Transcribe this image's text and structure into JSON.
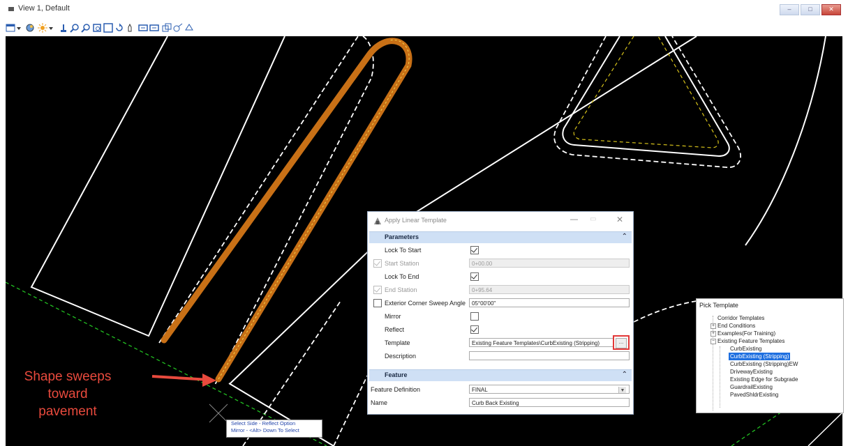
{
  "window": {
    "title": "View 1, Default",
    "controls": [
      "–",
      "□",
      "✕"
    ]
  },
  "dialog": {
    "title": "Apply Linear Template",
    "sections": {
      "parameters": "Parameters",
      "feature": "Feature"
    },
    "fields": {
      "lock_to_start": {
        "label": "Lock To Start",
        "checked": true
      },
      "start_station": {
        "label": "Start Station",
        "value": "0+00.00",
        "disabled": true
      },
      "lock_to_end": {
        "label": "Lock To End",
        "checked": true
      },
      "end_station": {
        "label": "End Station",
        "value": "0+95.64",
        "disabled": true
      },
      "corner_sweep": {
        "label": "Exterior Corner Sweep Angle",
        "value": "05°00'00\"",
        "checked": false
      },
      "mirror": {
        "label": "Mirror",
        "checked": false
      },
      "reflect": {
        "label": "Reflect",
        "checked": true
      },
      "template": {
        "label": "Template",
        "value": "Existing Feature Templates\\CurbExisting (Stripping)",
        "browse": "..."
      },
      "description": {
        "label": "Description",
        "value": ""
      },
      "feature_definition": {
        "label": "Feature Definition",
        "value": "FINAL"
      },
      "name": {
        "label": "Name",
        "value": "Curb Back Existing"
      }
    }
  },
  "pick_template": {
    "title": "Pick Template",
    "items": [
      {
        "label": "Corridor Templates",
        "level": 1
      },
      {
        "label": "End Conditions",
        "level": 1,
        "expander": "+"
      },
      {
        "label": "Examples(For Training)",
        "level": 1,
        "expander": "+"
      },
      {
        "label": "Existing Feature Templates",
        "level": 1,
        "expander": "−"
      },
      {
        "label": "CurbExisting",
        "level": 2
      },
      {
        "label": "CurbExisting (Stripping)",
        "level": 2,
        "selected": true
      },
      {
        "label": "CurbExisting (Stripping)EW",
        "level": 2
      },
      {
        "label": "DrivewayExisting",
        "level": 2
      },
      {
        "label": "Existing Edge for Subgrade",
        "level": 2
      },
      {
        "label": "GuardrailExisting",
        "level": 2
      },
      {
        "label": "PavedShldrExisting",
        "level": 2
      }
    ]
  },
  "hint": {
    "line1": "Select Side - Reflect Option",
    "line2": "Mirror - <Alt> Down To Select"
  },
  "callout": {
    "line1": "Shape sweeps",
    "line2": "toward",
    "line3": "pavement"
  },
  "colors": {
    "accent_orange": "#c87016",
    "callout_red": "#e84a3d",
    "selection_blue": "#1e6fe0",
    "guide_green": "#22c022"
  }
}
